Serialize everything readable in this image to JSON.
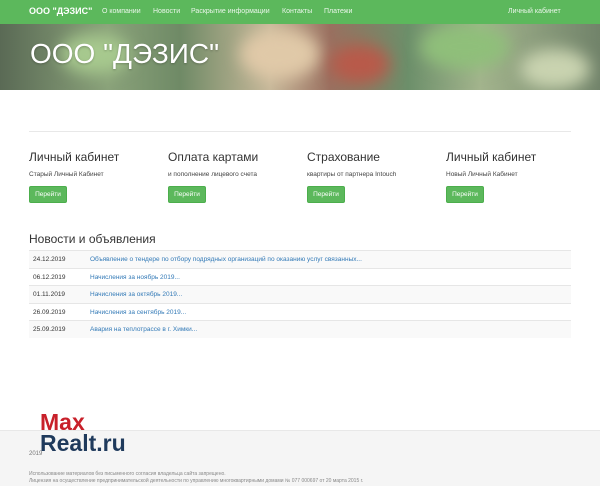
{
  "navbar": {
    "brand": "ООО \"ДЭЗИС\"",
    "links": [
      "О компании",
      "Новости",
      "Раскрытие информации",
      "Контакты",
      "Платежи"
    ],
    "right_link": "Личный кабинет"
  },
  "hero": {
    "title": "ООО \"ДЭЗИС\""
  },
  "cards": [
    {
      "title": "Личный кабинет",
      "text": "Старый Личный Кабинет",
      "button": "Перейти"
    },
    {
      "title": "Оплата картами",
      "text": "и пополнение лицевого счета",
      "button": "Перейти"
    },
    {
      "title": "Страхование",
      "text": "квартиры от партнера Intouch",
      "button": "Перейти"
    },
    {
      "title": "Личный кабинет",
      "text": "Новый Личный Кабинет",
      "button": "Перейти"
    }
  ],
  "news": {
    "title": "Новости и объявления",
    "items": [
      {
        "date": "24.12.2019",
        "text": "Объявление о тендере по отбору подрядных организаций по оказанию услуг связанных..."
      },
      {
        "date": "06.12.2019",
        "text": "Начисления за ноябрь 2019..."
      },
      {
        "date": "01.11.2019",
        "text": "Начисления за октябрь 2019..."
      },
      {
        "date": "26.09.2019",
        "text": "Начисления за сентябрь 2019..."
      },
      {
        "date": "25.09.2019",
        "text": "Авария на теплотрассе в г. Химки..."
      }
    ]
  },
  "footer": {
    "year": "2019",
    "line1": "Использование материалов без письменного согласия владельца сайта запрещено.",
    "line2": "Лицензия на осуществление предпринимательской деятельности по управлению многоквартирными домами № 077 000697 от 20 марта 2015 г."
  },
  "watermark": {
    "part1": "Max",
    "part2": "Realt",
    "part3": ".ru"
  },
  "colors": {
    "navbar": "#5cb85c",
    "button": "#5cb85c",
    "link": "#337ab7",
    "watermark_blue": "#1f3a5c",
    "watermark_red": "#c8202a"
  }
}
